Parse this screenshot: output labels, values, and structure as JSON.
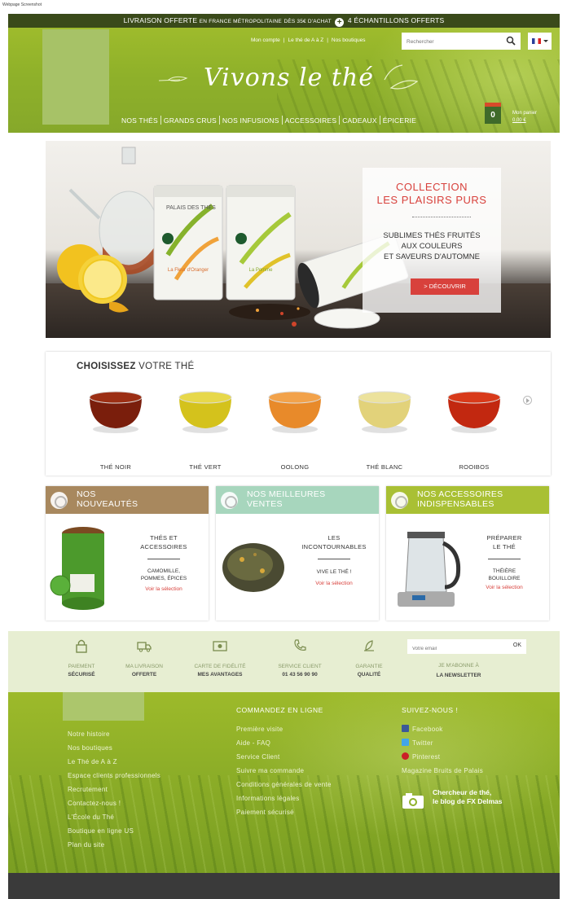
{
  "caption": "Webpage Screenshot",
  "topbar": {
    "part1": "LIVRAISON OFFERTE",
    "part2": "EN FRANCE MÉTROPOLITAINE",
    "part3": "DÈS 35€ D'ACHAT",
    "part4": "4 ÉCHANTILLONS OFFERTS"
  },
  "header": {
    "links": [
      "Mon compte",
      "Le thé de A à Z",
      "Nos boutiques"
    ],
    "search_placeholder": "Rechercher",
    "brand": "Vivons le thé",
    "nav": [
      "NOS THÉS",
      "GRANDS CRUS",
      "NOS INFUSIONS",
      "ACCESSOIRES",
      "CADEAUX",
      "ÉPICERIE"
    ],
    "cart_count": "0",
    "cart_label": "Mon panier",
    "cart_total": "0,00 €"
  },
  "hero": {
    "title_line1": "COLLECTION",
    "title_line2": "LES PLAISIRS PURS",
    "sub_line1": "SUBLIMES THÉS FRUITÉS",
    "sub_line2": "AUX COULEURS",
    "sub_line3": "ET SAVEURS D'AUTOMNE",
    "button": "> DÉCOUVRIR",
    "tin1_brand": "PALAIS DES THÉS",
    "tin1_name": "La Fleur d'Oranger",
    "tin2_name": "La Pomme"
  },
  "choose": {
    "title_bold": "CHOISISSEZ",
    "title_rest": "VOTRE THÉ",
    "teas": [
      "THÉ NOIR",
      "THÉ VERT",
      "OOLONG",
      "THÉ BLANC",
      "ROOIBOS"
    ]
  },
  "cards": [
    {
      "head_line1": "NOS",
      "head_line2": "NOUVEAUTÉS",
      "title_line1": "THÉS ET",
      "title_line2": "ACCESSOIRES",
      "desc_line1": "CAMOMILLE,",
      "desc_line2": "POMMES, ÉPICES",
      "link": "Voir la sélection",
      "color": "#a8885e"
    },
    {
      "head_line1": "NOS MEILLEURES",
      "head_line2": "VENTES",
      "title_line1": "LES",
      "title_line2": "INCONTOURNABLES",
      "desc_line1": "VIVE LE THÉ !",
      "desc_line2": "",
      "link": "Voir la sélection",
      "color": "#a7d6bd"
    },
    {
      "head_line1": "NOS ACCESSOIRES",
      "head_line2": "INDISPENSABLES",
      "title_line1": "PRÉPARER",
      "title_line2": "LE THÉ",
      "desc_line1": "THÉIÈRE",
      "desc_line2": "BOUILLOIRE",
      "link": "Voir la sélection",
      "color": "#a9c034"
    }
  ],
  "reassurance": [
    {
      "l1": "PAIEMENT",
      "l2": "SÉCURISÉ",
      "icon": "lock-icon"
    },
    {
      "l1": "MA LIVRAISON",
      "l2": "OFFERTE",
      "icon": "truck-icon"
    },
    {
      "l1": "CARTE DE FIDÉLITÉ",
      "l2": "MES AVANTAGES",
      "icon": "card-icon"
    },
    {
      "l1": "SERVICE CLIENT",
      "l2": "01 43 56 90 90",
      "icon": "phone-icon"
    },
    {
      "l1": "GARANTIE",
      "l2": "QUALITÉ",
      "icon": "leaf-icon"
    }
  ],
  "newsletter": {
    "placeholder": "Votre email",
    "ok": "OK",
    "l1": "JE M'ABONNE À",
    "l2": "LA NEWSLETTER"
  },
  "footer": {
    "col1": [
      "Notre histoire",
      "Nos boutiques",
      "Le Thé de A à Z",
      "Espace clients professionnels",
      "Recrutement",
      "Contactez-nous !",
      "L'École du Thé",
      "Boutique en ligne US",
      "Plan du site"
    ],
    "col2_title": "COMMANDEZ EN LIGNE",
    "col2": [
      "Première visite",
      "Aide - FAQ",
      "Service Client",
      "Suivre ma commande",
      "Conditions générales de vente",
      "Informations légales",
      "Paiement sécurisé"
    ],
    "col3_title": "SUIVEZ-NOUS !",
    "social": [
      {
        "label": "Facebook",
        "icon": "facebook-icon",
        "color": "#3b5998"
      },
      {
        "label": "Twitter",
        "icon": "twitter-icon",
        "color": "#42a5e8"
      },
      {
        "label": "Pinterest",
        "icon": "pinterest-icon",
        "color": "#cb2027"
      }
    ],
    "magazine": "Magazine Bruits de Palais",
    "blog_line1": "Chercheur de thé,",
    "blog_line2": "le blog de FX Delmas"
  }
}
